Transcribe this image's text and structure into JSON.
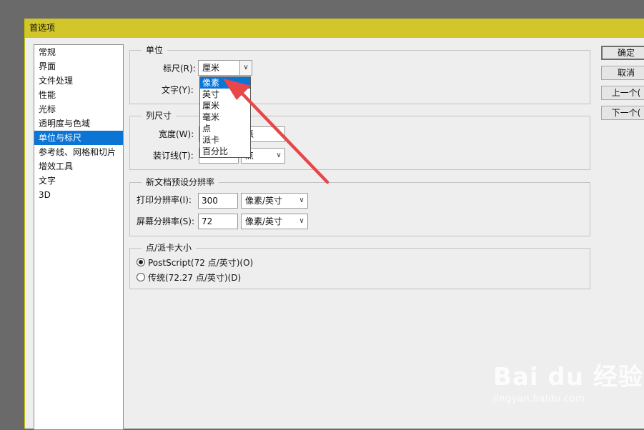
{
  "dialog": {
    "title": "首选项",
    "sidebar": [
      "常规",
      "界面",
      "文件处理",
      "性能",
      "光标",
      "透明度与色域",
      "单位与标尺",
      "参考线、网格和切片",
      "增效工具",
      "文字",
      "3D"
    ],
    "selected_index": 6,
    "buttons": {
      "ok": "确定",
      "cancel": "取消",
      "prev": "上一个(",
      "next": "下一个("
    }
  },
  "units": {
    "legend": "单位",
    "ruler_label": "标尺(R):",
    "ruler_value": "厘米",
    "type_label": "文字(Y):",
    "dropdown_options": [
      "像素",
      "英寸",
      "厘米",
      "毫米",
      "点",
      "派卡",
      "百分比"
    ],
    "highlighted_option": "像素"
  },
  "column_size": {
    "legend": "列尺寸",
    "width_label": "宽度(W):",
    "width_unit_partial": "派",
    "gutter_label": "装订线(T):",
    "gutter_unit": "点"
  },
  "new_doc": {
    "legend": "新文档预设分辨率",
    "print_label": "打印分辨率(I):",
    "print_value": "300",
    "print_unit": "像素/英寸",
    "screen_label": "屏幕分辨率(S):",
    "screen_value": "72",
    "screen_unit": "像素/英寸"
  },
  "point_size": {
    "legend": "点/派卡大小",
    "postscript": "PostScript(72 点/英寸)(O)",
    "traditional": "传统(72.27 点/英寸)(D)"
  },
  "watermark": {
    "brand": "Bai du 经验",
    "url": "jingyan.baidu.com"
  },
  "colors": {
    "titlebar": "#d2c72a",
    "selection": "#0b75d6",
    "arrow": "#e8474a"
  }
}
